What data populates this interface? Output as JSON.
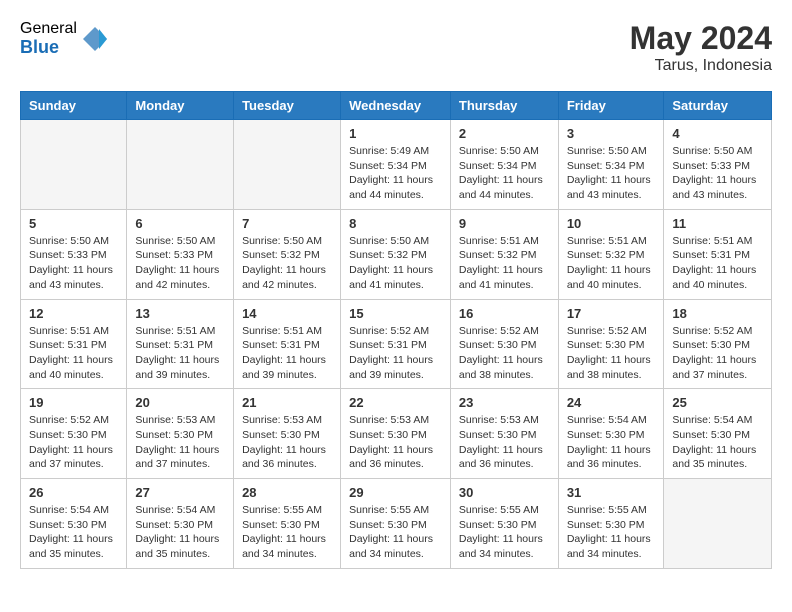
{
  "header": {
    "logo_general": "General",
    "logo_blue": "Blue",
    "month_year": "May 2024",
    "location": "Tarus, Indonesia"
  },
  "days_of_week": [
    "Sunday",
    "Monday",
    "Tuesday",
    "Wednesday",
    "Thursday",
    "Friday",
    "Saturday"
  ],
  "weeks": [
    [
      {
        "day": "",
        "info": "",
        "empty": true
      },
      {
        "day": "",
        "info": "",
        "empty": true
      },
      {
        "day": "",
        "info": "",
        "empty": true
      },
      {
        "day": "1",
        "sunrise": "5:49 AM",
        "sunset": "5:34 PM",
        "daylight": "11 hours and 44 minutes."
      },
      {
        "day": "2",
        "sunrise": "5:50 AM",
        "sunset": "5:34 PM",
        "daylight": "11 hours and 44 minutes."
      },
      {
        "day": "3",
        "sunrise": "5:50 AM",
        "sunset": "5:34 PM",
        "daylight": "11 hours and 43 minutes."
      },
      {
        "day": "4",
        "sunrise": "5:50 AM",
        "sunset": "5:33 PM",
        "daylight": "11 hours and 43 minutes."
      }
    ],
    [
      {
        "day": "5",
        "sunrise": "5:50 AM",
        "sunset": "5:33 PM",
        "daylight": "11 hours and 43 minutes."
      },
      {
        "day": "6",
        "sunrise": "5:50 AM",
        "sunset": "5:33 PM",
        "daylight": "11 hours and 42 minutes."
      },
      {
        "day": "7",
        "sunrise": "5:50 AM",
        "sunset": "5:32 PM",
        "daylight": "11 hours and 42 minutes."
      },
      {
        "day": "8",
        "sunrise": "5:50 AM",
        "sunset": "5:32 PM",
        "daylight": "11 hours and 41 minutes."
      },
      {
        "day": "9",
        "sunrise": "5:51 AM",
        "sunset": "5:32 PM",
        "daylight": "11 hours and 41 minutes."
      },
      {
        "day": "10",
        "sunrise": "5:51 AM",
        "sunset": "5:32 PM",
        "daylight": "11 hours and 40 minutes."
      },
      {
        "day": "11",
        "sunrise": "5:51 AM",
        "sunset": "5:31 PM",
        "daylight": "11 hours and 40 minutes."
      }
    ],
    [
      {
        "day": "12",
        "sunrise": "5:51 AM",
        "sunset": "5:31 PM",
        "daylight": "11 hours and 40 minutes."
      },
      {
        "day": "13",
        "sunrise": "5:51 AM",
        "sunset": "5:31 PM",
        "daylight": "11 hours and 39 minutes."
      },
      {
        "day": "14",
        "sunrise": "5:51 AM",
        "sunset": "5:31 PM",
        "daylight": "11 hours and 39 minutes."
      },
      {
        "day": "15",
        "sunrise": "5:52 AM",
        "sunset": "5:31 PM",
        "daylight": "11 hours and 39 minutes."
      },
      {
        "day": "16",
        "sunrise": "5:52 AM",
        "sunset": "5:30 PM",
        "daylight": "11 hours and 38 minutes."
      },
      {
        "day": "17",
        "sunrise": "5:52 AM",
        "sunset": "5:30 PM",
        "daylight": "11 hours and 38 minutes."
      },
      {
        "day": "18",
        "sunrise": "5:52 AM",
        "sunset": "5:30 PM",
        "daylight": "11 hours and 37 minutes."
      }
    ],
    [
      {
        "day": "19",
        "sunrise": "5:52 AM",
        "sunset": "5:30 PM",
        "daylight": "11 hours and 37 minutes."
      },
      {
        "day": "20",
        "sunrise": "5:53 AM",
        "sunset": "5:30 PM",
        "daylight": "11 hours and 37 minutes."
      },
      {
        "day": "21",
        "sunrise": "5:53 AM",
        "sunset": "5:30 PM",
        "daylight": "11 hours and 36 minutes."
      },
      {
        "day": "22",
        "sunrise": "5:53 AM",
        "sunset": "5:30 PM",
        "daylight": "11 hours and 36 minutes."
      },
      {
        "day": "23",
        "sunrise": "5:53 AM",
        "sunset": "5:30 PM",
        "daylight": "11 hours and 36 minutes."
      },
      {
        "day": "24",
        "sunrise": "5:54 AM",
        "sunset": "5:30 PM",
        "daylight": "11 hours and 36 minutes."
      },
      {
        "day": "25",
        "sunrise": "5:54 AM",
        "sunset": "5:30 PM",
        "daylight": "11 hours and 35 minutes."
      }
    ],
    [
      {
        "day": "26",
        "sunrise": "5:54 AM",
        "sunset": "5:30 PM",
        "daylight": "11 hours and 35 minutes."
      },
      {
        "day": "27",
        "sunrise": "5:54 AM",
        "sunset": "5:30 PM",
        "daylight": "11 hours and 35 minutes."
      },
      {
        "day": "28",
        "sunrise": "5:55 AM",
        "sunset": "5:30 PM",
        "daylight": "11 hours and 34 minutes."
      },
      {
        "day": "29",
        "sunrise": "5:55 AM",
        "sunset": "5:30 PM",
        "daylight": "11 hours and 34 minutes."
      },
      {
        "day": "30",
        "sunrise": "5:55 AM",
        "sunset": "5:30 PM",
        "daylight": "11 hours and 34 minutes."
      },
      {
        "day": "31",
        "sunrise": "5:55 AM",
        "sunset": "5:30 PM",
        "daylight": "11 hours and 34 minutes."
      },
      {
        "day": "",
        "info": "",
        "empty": true
      }
    ]
  ]
}
